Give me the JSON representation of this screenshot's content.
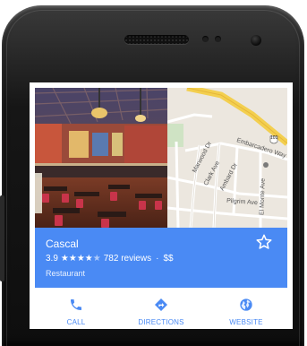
{
  "place": {
    "name": "Cascal",
    "rating": "3.9",
    "stars_filled": 4,
    "reviews": "782 reviews",
    "price": "$$",
    "category": "Restaurant"
  },
  "map_labels": {
    "embarcadero": "Embarcadero Way",
    "marwood": "Marwood Dr",
    "clark": "Clark Ave",
    "ambard": "Ambard Dr",
    "pilgrim": "Pilgrim Ave",
    "el_monte": "El Monte Ave",
    "highway_shield": "101"
  },
  "actions": {
    "call": "CALL",
    "directions": "DIRECTIONS",
    "website": "WEBSITE"
  },
  "icons": {
    "call": "phone-icon",
    "directions": "directions-icon",
    "website": "globe-icon",
    "save": "star-outline-icon"
  },
  "colors": {
    "accent": "#4a8af4",
    "phone_body": "#161616"
  }
}
